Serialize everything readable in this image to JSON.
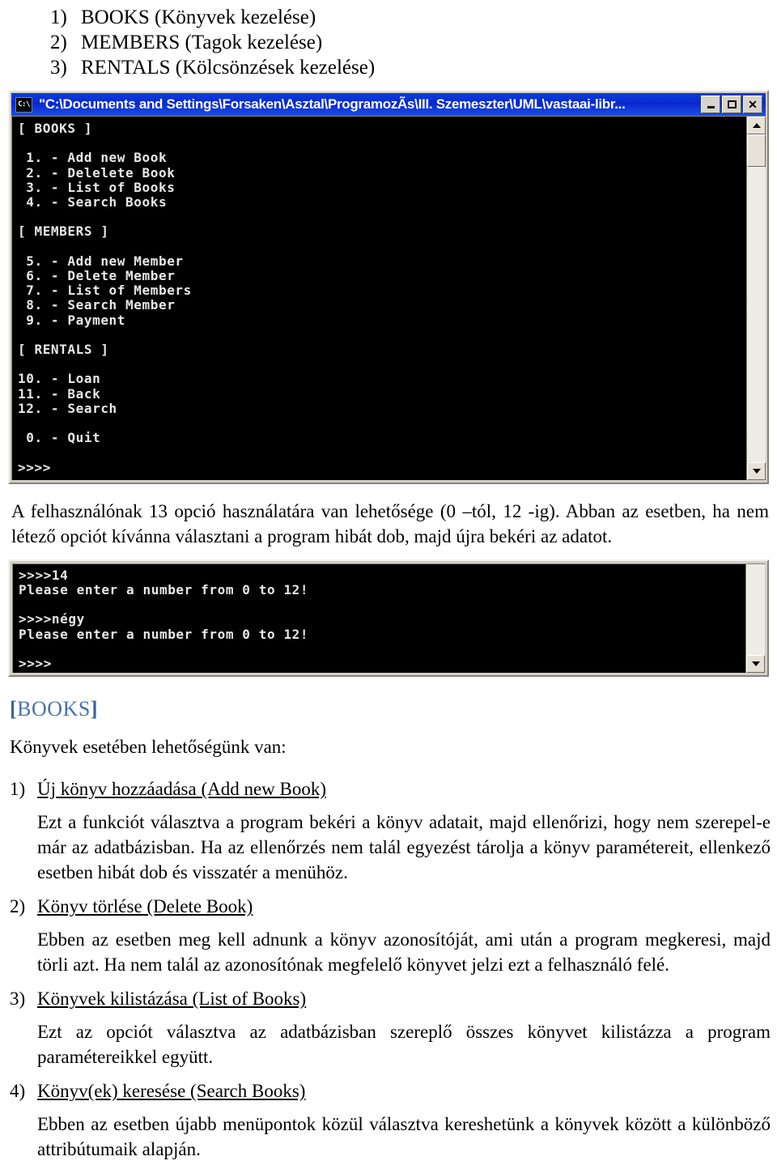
{
  "top_list": [
    {
      "num": "1)",
      "text": "BOOKS (Könyvek kezelése)"
    },
    {
      "num": "2)",
      "text": "MEMBERS (Tagok kezelése)"
    },
    {
      "num": "3)",
      "text": "RENTALS (Kölcsönzések kezelése)"
    }
  ],
  "console_main": {
    "title": "\"C:\\Documents and Settings\\Forsaken\\Asztal\\ProgramozÃs\\III. Szemeszter\\UML\\vastaai-libr...",
    "icon_label": "C:\\",
    "buttons": {
      "minimize": "minimize-button",
      "maximize": "maximize-button",
      "close": "✕"
    },
    "screen_text": "[ BOOKS ]\n\n 1. - Add new Book\n 2. - Delelete Book\n 3. - List of Books\n 4. - Search Books\n\n[ MEMBERS ]\n\n 5. - Add new Member\n 6. - Delete Member\n 7. - List of Members\n 8. - Search Member\n 9. - Payment\n\n[ RENTALS ]\n\n10. - Loan\n11. - Back\n12. - Search\n\n 0. - Quit\n\n>>>>"
  },
  "paragraph_between": "A felhasználónak 13 opció használatára van lehetősége (0 –tól, 12 -ig). Abban az esetben, ha nem létező opciót kívánna választani a program hibát dob, majd újra bekéri az adatot.",
  "console_error": {
    "screen_text": ">>>>14\nPlease enter a number from 0 to 12!\n\n>>>>négy\nPlease enter a number from 0 to 12!\n\n>>>>"
  },
  "section": {
    "heading_open": "[",
    "heading_label": "BOOKS",
    "heading_close": "]",
    "lead": "Könyvek esetében lehetőségünk van:"
  },
  "items": [
    {
      "num": "1)",
      "title": "Új könyv hozzáadása (Add new Book)",
      "body": "Ezt a funkciót választva a program bekéri a könyv adatait, majd ellenőrizi, hogy nem szerepel-e már az adatbázisban. Ha az ellenőrzés nem talál egyezést tárolja a könyv paramétereit, ellenkező esetben hibát dob és visszatér a menühöz."
    },
    {
      "num": "2)",
      "title": "Könyv törlése (Delete Book)",
      "body": "Ebben az esetben meg kell adnunk a könyv azonosítóját, ami után a program megkeresi, majd törli azt. Ha nem talál az azonosítónak megfelelő könyvet jelzi ezt a felhasználó felé."
    },
    {
      "num": "3)",
      "title": "Könyvek kilistázása (List of Books)",
      "body": "Ezt az opciót választva az adatbázisban szereplő összes könyvet kilistázza a program paramétereikkel együtt."
    },
    {
      "num": "4)",
      "title": "Könyv(ek) keresése (Search Books)",
      "body": "Ebben az esetben újabb menüpontok közül választva kereshetünk a könyvek között a különböző attribútumaik alapján."
    }
  ],
  "colors": {
    "titlebar_blue": "#0a28cf",
    "heading_blue": "#4a72a8",
    "console_bg": "#000000",
    "console_fg": "#e8e8e8",
    "chrome": "#d4d0c8"
  }
}
